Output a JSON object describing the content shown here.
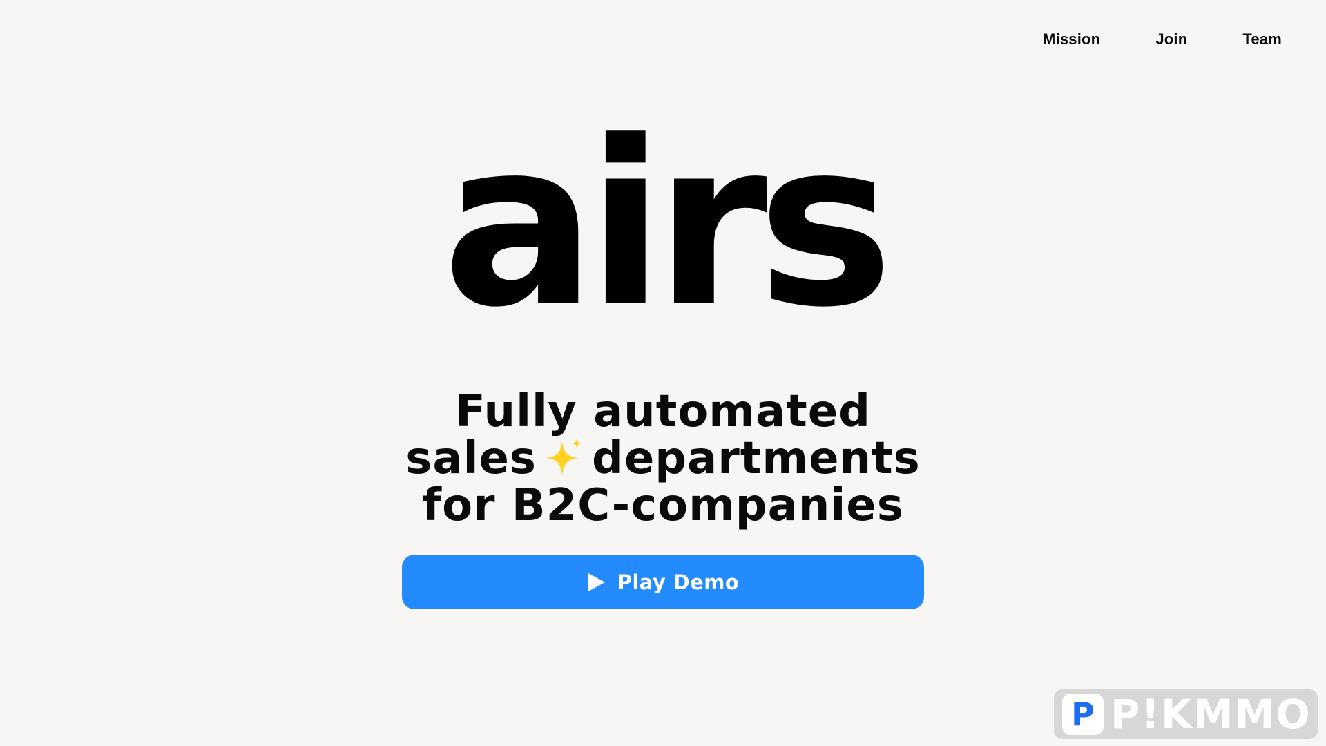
{
  "nav": {
    "items": [
      {
        "label": "Mission"
      },
      {
        "label": "Join"
      },
      {
        "label": "Team"
      }
    ]
  },
  "hero": {
    "logo_text": "airs",
    "tagline": {
      "line1": "Fully automated",
      "line2_before": "sales",
      "line2_after": "departments",
      "line3": "for B2C-companies"
    },
    "sparkle_icon": "sparkle-icon",
    "cta": {
      "label": "Play Demo",
      "icon": "play-icon",
      "color": "#248bff"
    }
  },
  "watermark": {
    "badge": "P",
    "text": "P!KMMO"
  },
  "colors": {
    "background": "#f7f6f4",
    "text": "#000000",
    "accent": "#248bff",
    "sparkle": "#ffd21f"
  }
}
